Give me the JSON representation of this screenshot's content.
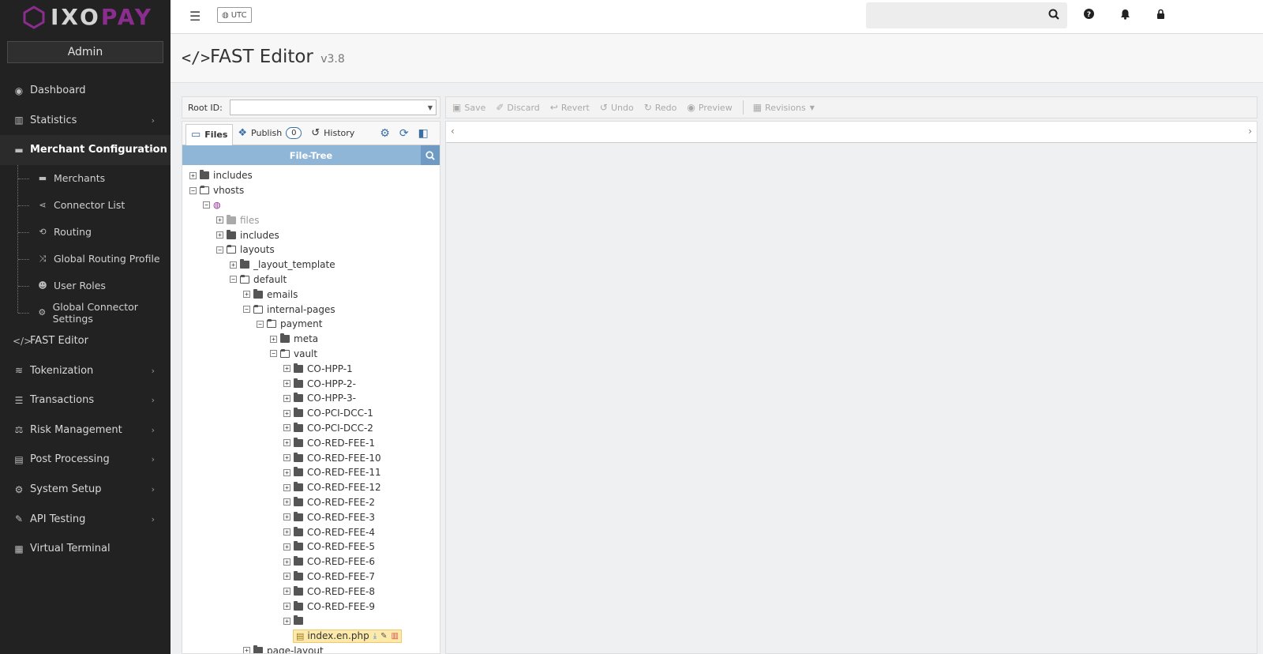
{
  "brand": {
    "logo_text_a": "IXO",
    "logo_text_b": "PAY",
    "accent_color": "#8b2d8e"
  },
  "sidebar": {
    "user_label": "Admin",
    "items": [
      {
        "label": "Dashboard",
        "icon": "dashboard-icon",
        "glyph": "◉",
        "chevron": false
      },
      {
        "label": "Statistics",
        "icon": "bar-chart-icon",
        "glyph": "▥",
        "chevron": true
      },
      {
        "label": "Merchant Configuration",
        "icon": "briefcase-icon",
        "glyph": "▬",
        "chevron": true
      }
    ],
    "sub_items": [
      {
        "label": "Merchants",
        "icon": "briefcase-icon",
        "glyph": "▬"
      },
      {
        "label": "Connector List",
        "icon": "share-icon",
        "glyph": "⋖"
      },
      {
        "label": "Routing",
        "icon": "route-icon",
        "glyph": "⟲"
      },
      {
        "label": "Global Routing Profile",
        "icon": "random-icon",
        "glyph": "⤨"
      },
      {
        "label": "User Roles",
        "icon": "users-icon",
        "glyph": "☻"
      },
      {
        "label": "Global Connector Settings",
        "icon": "gear-icon",
        "glyph": "⚙"
      }
    ],
    "items_after": [
      {
        "label": "FAST Editor",
        "icon": "code-icon",
        "glyph": "</>",
        "chevron": false
      },
      {
        "label": "Tokenization",
        "icon": "tokenization-icon",
        "glyph": "≋",
        "chevron": true
      },
      {
        "label": "Transactions",
        "icon": "list-icon",
        "glyph": "☰",
        "chevron": true
      },
      {
        "label": "Risk Management",
        "icon": "balance-scale-icon",
        "glyph": "⚖",
        "chevron": true
      },
      {
        "label": "Post Processing",
        "icon": "database-icon",
        "glyph": "▤",
        "chevron": true
      },
      {
        "label": "System Setup",
        "icon": "gear-icon",
        "glyph": "⚙",
        "chevron": true
      },
      {
        "label": "API Testing",
        "icon": "wrench-icon",
        "glyph": "✎",
        "chevron": true
      },
      {
        "label": "Virtual Terminal",
        "icon": "calculator-icon",
        "glyph": "▦",
        "chevron": false
      }
    ]
  },
  "topbar": {
    "timezone": "UTC"
  },
  "page": {
    "title": "FAST Editor",
    "version": "v3.8"
  },
  "root": {
    "label": "Root ID:",
    "value": ""
  },
  "toolbar": {
    "save": "Save",
    "discard": "Discard",
    "revert": "Revert",
    "undo": "Undo",
    "redo": "Redo",
    "preview": "Preview",
    "revisions": "Revisions"
  },
  "tabs": {
    "files": "Files",
    "publish": "Publish",
    "publish_count": "0",
    "history": "History"
  },
  "tree": {
    "header": "File-Tree",
    "nodes": [
      {
        "label": "includes",
        "depth": 0,
        "expanded": false,
        "kind": "folder"
      },
      {
        "label": "vhosts",
        "depth": 0,
        "expanded": true,
        "kind": "folder"
      },
      {
        "label": "",
        "depth": 1,
        "expanded": true,
        "kind": "host"
      },
      {
        "label": "files",
        "depth": 2,
        "expanded": false,
        "kind": "folder-dim"
      },
      {
        "label": "includes",
        "depth": 2,
        "expanded": false,
        "kind": "folder"
      },
      {
        "label": "layouts",
        "depth": 2,
        "expanded": true,
        "kind": "folder"
      },
      {
        "label": "_layout_template",
        "depth": 3,
        "expanded": false,
        "kind": "folder"
      },
      {
        "label": "default",
        "depth": 3,
        "expanded": true,
        "kind": "folder"
      },
      {
        "label": "emails",
        "depth": 4,
        "expanded": false,
        "kind": "folder"
      },
      {
        "label": "internal-pages",
        "depth": 4,
        "expanded": true,
        "kind": "folder"
      },
      {
        "label": "payment",
        "depth": 5,
        "expanded": true,
        "kind": "folder"
      },
      {
        "label": "meta",
        "depth": 6,
        "expanded": false,
        "kind": "folder"
      },
      {
        "label": "vault",
        "depth": 6,
        "expanded": true,
        "kind": "folder"
      },
      {
        "label": "CO-HPP-1",
        "depth": 7,
        "expanded": false,
        "kind": "folder"
      },
      {
        "label": "CO-HPP-2-",
        "depth": 7,
        "expanded": false,
        "kind": "folder"
      },
      {
        "label": "CO-HPP-3-",
        "depth": 7,
        "expanded": false,
        "kind": "folder"
      },
      {
        "label": "CO-PCI-DCC-1",
        "depth": 7,
        "expanded": false,
        "kind": "folder"
      },
      {
        "label": "CO-PCI-DCC-2",
        "depth": 7,
        "expanded": false,
        "kind": "folder"
      },
      {
        "label": "CO-RED-FEE-1",
        "depth": 7,
        "expanded": false,
        "kind": "folder"
      },
      {
        "label": "CO-RED-FEE-10",
        "depth": 7,
        "expanded": false,
        "kind": "folder"
      },
      {
        "label": "CO-RED-FEE-11",
        "depth": 7,
        "expanded": false,
        "kind": "folder"
      },
      {
        "label": "CO-RED-FEE-12",
        "depth": 7,
        "expanded": false,
        "kind": "folder"
      },
      {
        "label": "CO-RED-FEE-2",
        "depth": 7,
        "expanded": false,
        "kind": "folder"
      },
      {
        "label": "CO-RED-FEE-3",
        "depth": 7,
        "expanded": false,
        "kind": "folder"
      },
      {
        "label": "CO-RED-FEE-4",
        "depth": 7,
        "expanded": false,
        "kind": "folder"
      },
      {
        "label": "CO-RED-FEE-5",
        "depth": 7,
        "expanded": false,
        "kind": "folder"
      },
      {
        "label": "CO-RED-FEE-6",
        "depth": 7,
        "expanded": false,
        "kind": "folder"
      },
      {
        "label": "CO-RED-FEE-7",
        "depth": 7,
        "expanded": false,
        "kind": "folder"
      },
      {
        "label": "CO-RED-FEE-8",
        "depth": 7,
        "expanded": false,
        "kind": "folder"
      },
      {
        "label": "CO-RED-FEE-9",
        "depth": 7,
        "expanded": false,
        "kind": "folder"
      },
      {
        "label": "",
        "depth": 7,
        "expanded": false,
        "kind": "folder"
      },
      {
        "label": "index.en.php",
        "depth": 7,
        "expanded": false,
        "kind": "file"
      },
      {
        "label": "page-layout",
        "depth": 4,
        "expanded": false,
        "kind": "folder"
      }
    ]
  }
}
